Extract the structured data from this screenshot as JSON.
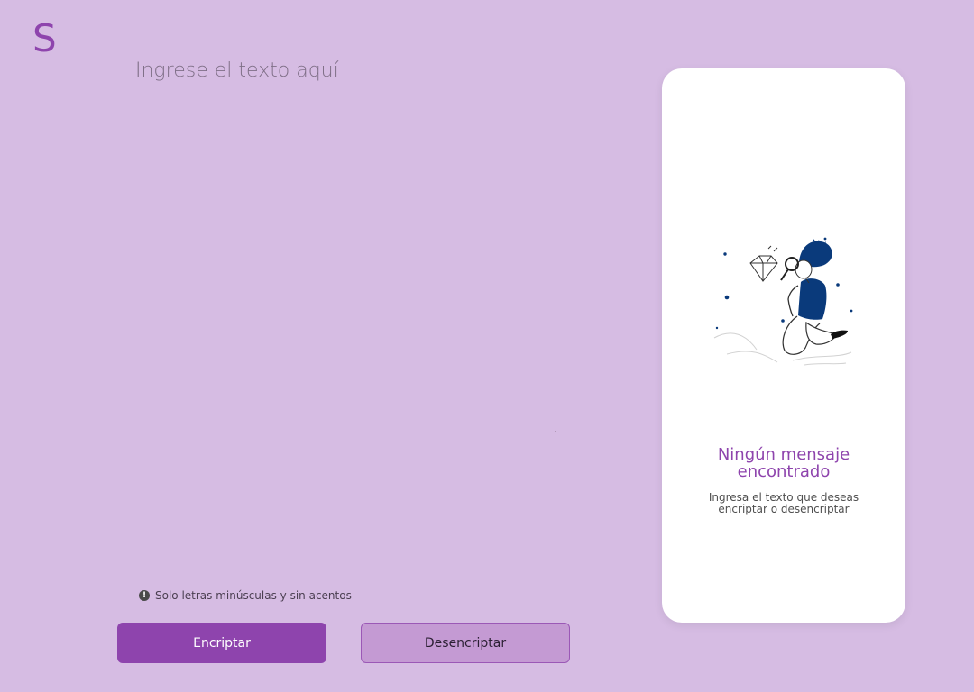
{
  "app": {
    "logo_text": "S"
  },
  "editor": {
    "placeholder": "Ingrese el texto aquí",
    "value": ""
  },
  "hint": {
    "text": "Solo letras minúsculas y sin acentos",
    "icon": "exclamation-circle-icon"
  },
  "buttons": {
    "encrypt_label": "Encriptar",
    "decrypt_label": "Desencriptar"
  },
  "output_panel": {
    "title": "Ningún mensaje encontrado",
    "subtitle": "Ingresa el texto que deseas encriptar o desencriptar",
    "illustration": "person-searching-diamond-illustration"
  },
  "colors": {
    "background": "#d6bce3",
    "accent": "#8e44ad",
    "secondary_button": "#c49ad3",
    "card_background": "#ffffff",
    "illustration_blue": "#0a3a7b"
  }
}
